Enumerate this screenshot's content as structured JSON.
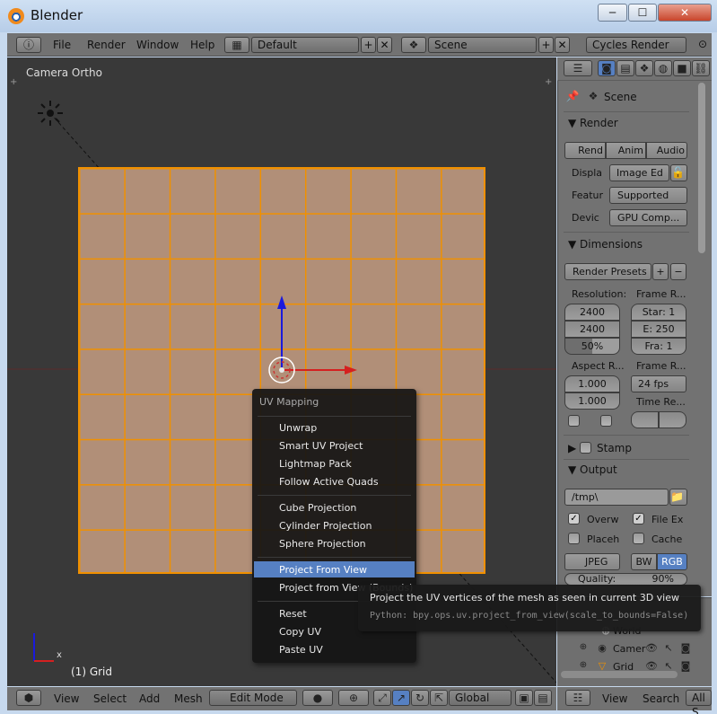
{
  "window": {
    "title": "Blender",
    "min_glyph": "─",
    "max_glyph": "☐",
    "close_glyph": "✕"
  },
  "topbar": {
    "info_glyph": "ⓘ",
    "menus": [
      "File",
      "Render",
      "Window",
      "Help"
    ],
    "layout_value": "Default",
    "scene_value": "Scene",
    "render_engine": "Cycles Render",
    "add_glyph": "+",
    "remove_glyph": "✕"
  },
  "viewport": {
    "view_label": "Camera Ortho",
    "object_label": "(1) Grid",
    "axis_x": "x",
    "plus_glyph": "+"
  },
  "bottombar": {
    "menus": [
      "View",
      "Select",
      "Add",
      "Mesh"
    ],
    "mode": "Edit Mode",
    "orientation": "Global"
  },
  "properties": {
    "scene_label": "Scene",
    "render_section": "Render",
    "render_buttons": [
      "Rend",
      "Anim",
      "Audio"
    ],
    "display_label": "Displa",
    "display_value": "Image Ed",
    "feature_label": "Featur",
    "feature_value": "Supported",
    "device_label": "Devic",
    "device_value": "GPU Comp...",
    "dimensions_section": "Dimensions",
    "render_presets": "Render Presets",
    "resolution_label": "Resolution:",
    "res_x": "2400",
    "res_y": "2400",
    "res_pct": "50%",
    "frame_range_label": "Frame R...",
    "frame_start": "Star: 1",
    "frame_end": "E: 250",
    "frame_step": "Fra: 1",
    "aspect_label": "Aspect R...",
    "aspect_x": "1.000",
    "aspect_y": "1.000",
    "frame_rate_label": "Frame R...",
    "frame_rate_value": "24 fps",
    "time_remap_label": "Time Re...",
    "stamp_section": "Stamp",
    "output_section": "Output",
    "output_path": "/tmp\\",
    "overwrite_label": "Overw",
    "file_ext_label": "File Ex",
    "placeholders_label": "Placeh",
    "cache_label": "Cache",
    "format_value": "JPEG",
    "bw_label": "BW",
    "rgb_label": "RGB",
    "quality_label": "Quality:",
    "quality_value": "90%"
  },
  "outliner": {
    "items": [
      "World",
      "Camer",
      "Grid"
    ],
    "bar_menus": [
      "View",
      "Search"
    ],
    "filter_value": "All S"
  },
  "uv_menu": {
    "title": "UV Mapping",
    "group1": [
      "Unwrap",
      "Smart UV Project",
      "Lightmap Pack",
      "Follow Active Quads"
    ],
    "group2": [
      "Cube Projection",
      "Cylinder Projection",
      "Sphere Projection"
    ],
    "group3": [
      "Project From View",
      "Project from View (Bounds)"
    ],
    "group4": [
      "Reset",
      "Copy UV",
      "Paste UV"
    ]
  },
  "tooltip": {
    "description": "Project the UV vertices of the mesh as seen in current 3D view",
    "python": "Python: bpy.ops.uv.project_from_view(scale_to_bounds=False)"
  },
  "colors": {
    "mesh_edge": "#f09000",
    "mesh_face": "#b18f78",
    "menu_highlight": "#5680c2",
    "axis_x": "#d42020",
    "axis_z": "#1a1adc"
  }
}
